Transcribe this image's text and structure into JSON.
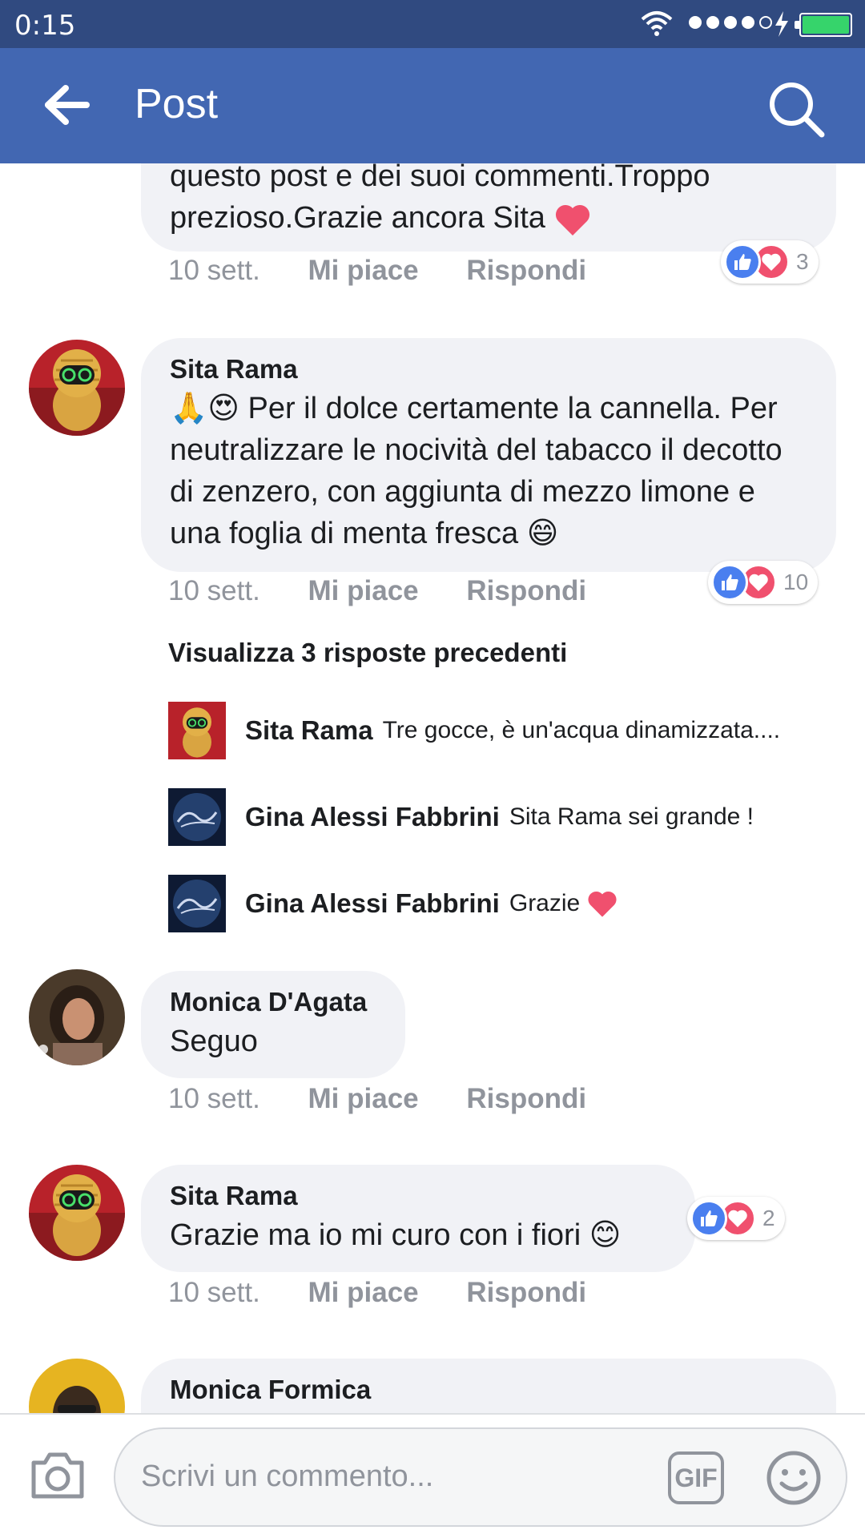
{
  "status_bar": {
    "time": "0:15"
  },
  "header": {
    "title": "Post"
  },
  "comments": [
    {
      "text_lines": [
        "questo post e dei suoi commenti.Troppo",
        "prezioso.Grazie ancora Sita"
      ],
      "time": "10 sett.",
      "like": "Mi piace",
      "reply": "Rispondi",
      "reaction_count": "3"
    },
    {
      "author": "Sita Rama",
      "text": "🙏😍 Per il dolce certamente la cannella. Per neutralizzare le nocività del tabacco il decotto di zenzero, con aggiunta di mezzo limone e una foglia di menta fresca 😄",
      "time": "10 sett.",
      "like": "Mi piace",
      "reply": "Rispondi",
      "reaction_count": "10",
      "view_previous": "Visualizza 3 risposte precedenti",
      "replies": [
        {
          "author": "Sita Rama",
          "text": "Tre gocce, è un'acqua dinamizzata...."
        },
        {
          "author": "Gina Alessi Fabbrini",
          "text": "Sita Rama sei grande !"
        },
        {
          "author": "Gina Alessi Fabbrini",
          "text": "Grazie"
        }
      ]
    },
    {
      "author": "Monica D'Agata",
      "text": "Seguo",
      "time": "10 sett.",
      "like": "Mi piace",
      "reply": "Rispondi"
    },
    {
      "author": "Sita Rama",
      "text": "Grazie ma io mi curo con i fiori 😊",
      "time": "10 sett.",
      "like": "Mi piace",
      "reply": "Rispondi",
      "reaction_count": "2"
    },
    {
      "author": "Monica Formica"
    }
  ],
  "composer": {
    "placeholder": "Scrivi un commento...",
    "gif_label": "GIF"
  },
  "colors": {
    "header": "#4267b2",
    "status_bar": "#304a80",
    "like_blue": "#4a7fef",
    "love_red": "#f0506e"
  }
}
